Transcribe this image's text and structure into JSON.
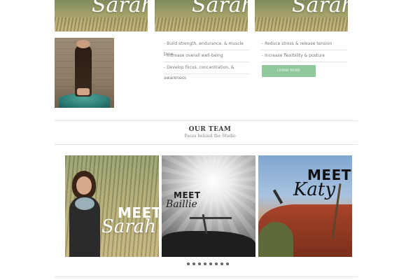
{
  "top_cards": [
    {
      "name": "Sarah"
    },
    {
      "name": "Sarah"
    },
    {
      "name": "Sarah"
    }
  ],
  "benefits_col1": [
    "- Build strength, endurance, & muscle tone",
    "- Increase overall well-being",
    "- Develop focus, concentration, & awareness"
  ],
  "benefits_col2": [
    "- Reduce stress & release tension",
    "- Increase flexibility & posture"
  ],
  "learn_more_label": "LEARN MORE",
  "team": {
    "title": "OUR TEAM",
    "subtitle": "Faces behind the Studio",
    "members": [
      {
        "meet": "MEET",
        "name": "Sarah"
      },
      {
        "meet": "MEET",
        "name": "Baillie"
      },
      {
        "meet": "MEET",
        "name": "Katy"
      }
    ],
    "slider_dots": 8
  },
  "colors": {
    "button": "#8fc99b",
    "divider": "#e3e3e3",
    "heading": "#3b3b3b"
  }
}
